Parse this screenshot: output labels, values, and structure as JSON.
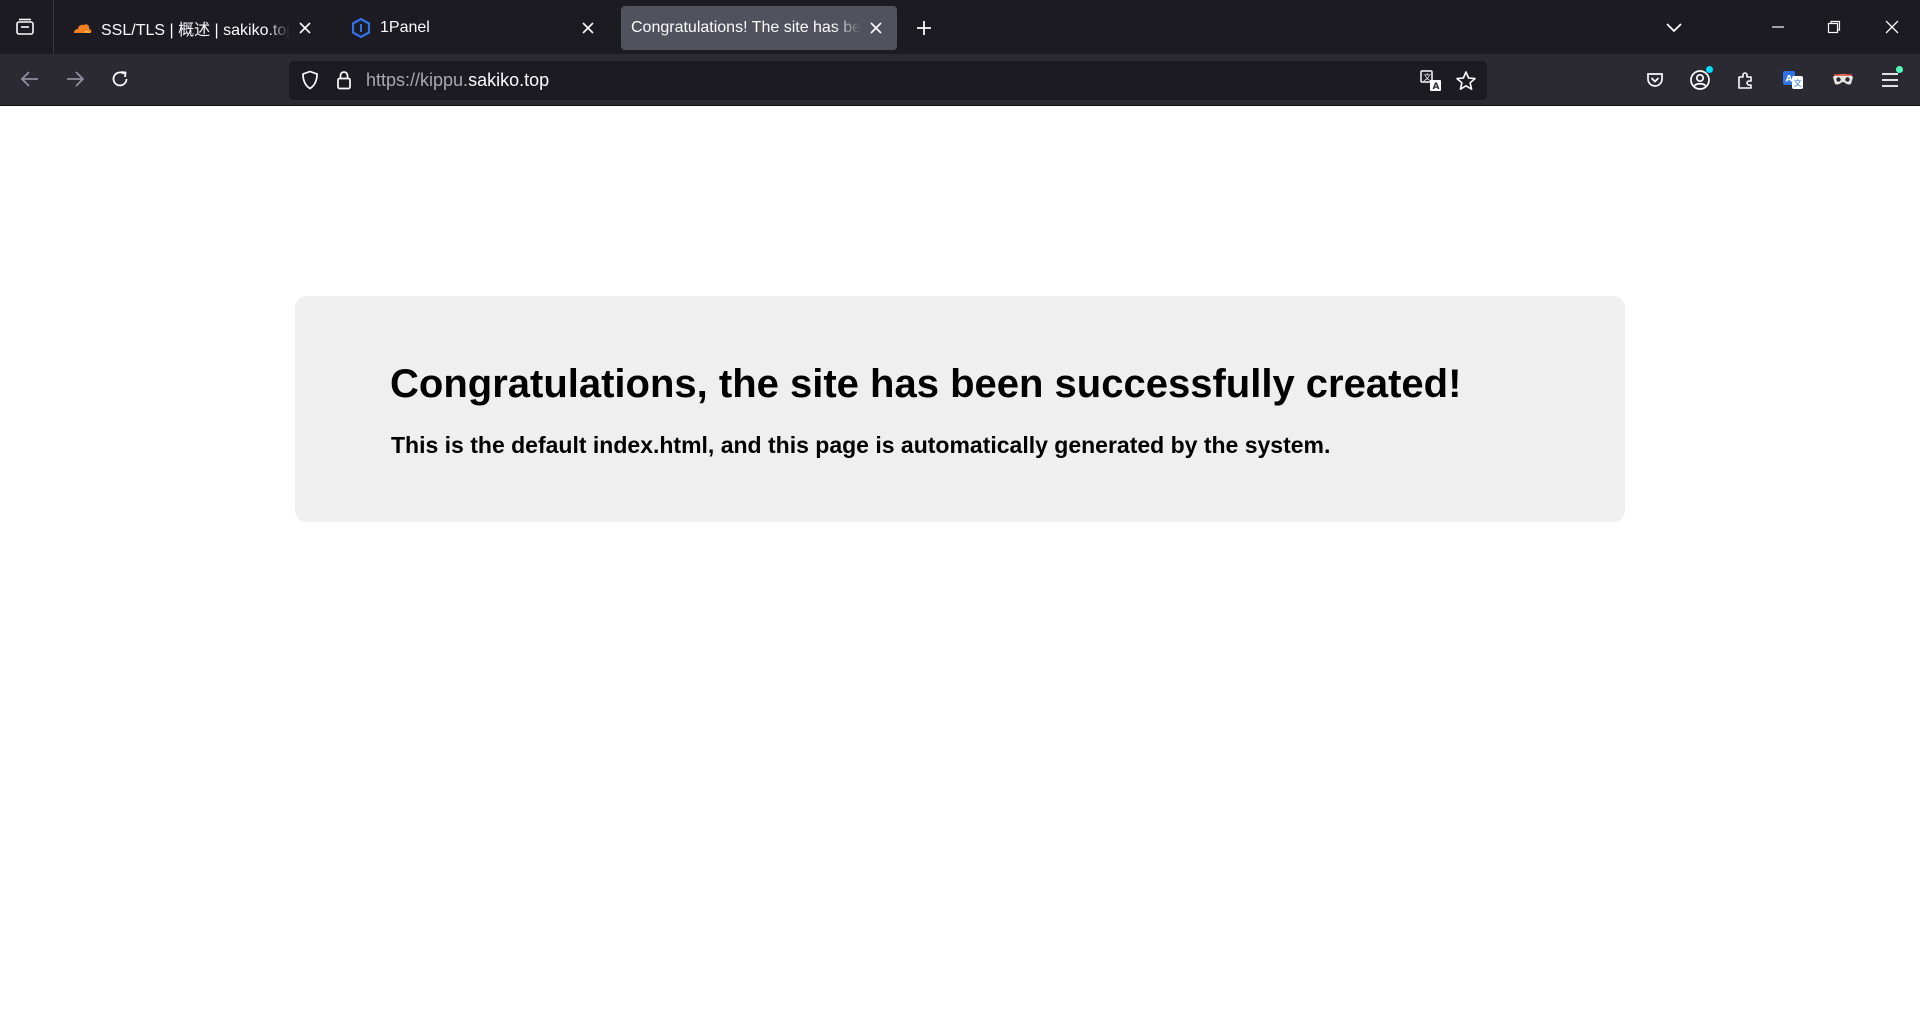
{
  "browser": {
    "tabs": [
      {
        "title": "SSL/TLS | 概述 | sakiko.top | K",
        "favicon": "cloudflare-icon",
        "active": false
      },
      {
        "title": "1Panel",
        "favicon": "1panel-icon",
        "active": false
      },
      {
        "title": "Congratulations! The site has been",
        "favicon": "",
        "active": true
      }
    ],
    "url": {
      "scheme_sub": "https://kippu.",
      "domain": "sakiko.top"
    },
    "toolbar_icons": [
      "pocket-icon",
      "account-icon",
      "extensions-icon",
      "translate-extension-icon",
      "mask-extension-icon",
      "menu-icon"
    ],
    "accent_colors": {
      "cloudflare": "#f38020",
      "onepanel": "#2f73e8",
      "active_tab": "#52525e",
      "tabbar": "#1c1b22",
      "toolbar": "#2b2a33"
    }
  },
  "page": {
    "heading": "Congratulations, the site has been successfully created!",
    "subheading": "This is the default index.html, and this page is automatically generated by the system.",
    "card_background": "#efefef"
  }
}
